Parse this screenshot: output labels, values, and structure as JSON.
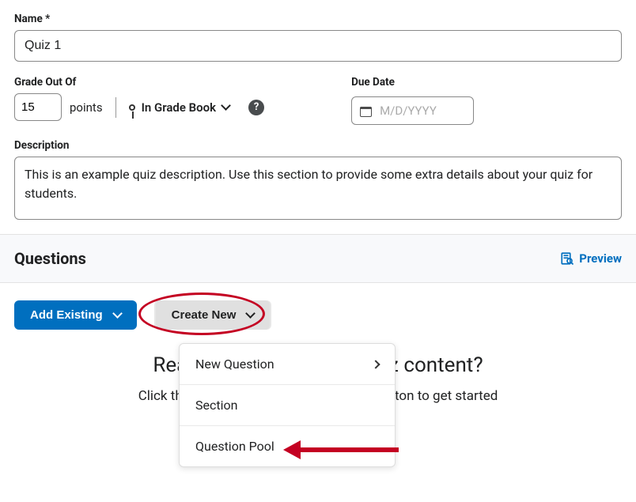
{
  "name": {
    "label": "Name *",
    "value": "Quiz 1"
  },
  "grade": {
    "label": "Grade Out Of",
    "value": "15",
    "points_label": "points",
    "gradebook_label": "In Grade Book",
    "help_glyph": "?"
  },
  "due": {
    "label": "Due Date",
    "placeholder": "M/D/YYYY"
  },
  "description": {
    "label": "Description",
    "value": "This is an example quiz description. Use this section to provide some extra details about your quiz for students."
  },
  "questions": {
    "title": "Questions",
    "preview_label": "Preview"
  },
  "buttons": {
    "add_existing_label": "Add Existing",
    "create_new_label": "Create New"
  },
  "create_menu": {
    "items": [
      {
        "label": "New Question",
        "has_submenu": true
      },
      {
        "label": "Section",
        "has_submenu": false
      },
      {
        "label": "Question Pool",
        "has_submenu": false
      }
    ]
  },
  "empty": {
    "title": "Ready to begin adding quiz content?",
    "subtitle": "Click the \"Add Existing\" or \"Create New\" button to get started"
  }
}
